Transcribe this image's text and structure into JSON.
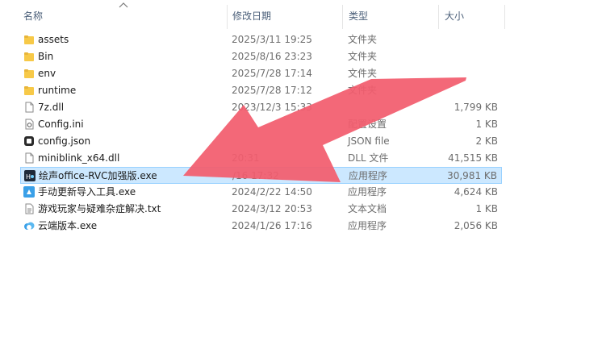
{
  "columns": {
    "name": "名称",
    "date": "修改日期",
    "type": "类型",
    "size": "大小"
  },
  "rows": [
    {
      "name": "assets",
      "date": "2025/3/11 19:25",
      "type": "文件夹",
      "size": "",
      "icon": "folder-icon"
    },
    {
      "name": "Bin",
      "date": "2025/8/16 23:23",
      "type": "文件夹",
      "size": "",
      "icon": "folder-icon"
    },
    {
      "name": "env",
      "date": "2025/7/28 17:14",
      "type": "文件夹",
      "size": "",
      "icon": "folder-icon"
    },
    {
      "name": "runtime",
      "date": "2025/7/28 17:12",
      "type": "文件夹",
      "size": "",
      "icon": "folder-icon"
    },
    {
      "name": "7z.dll",
      "date": "2023/12/3 15:33",
      "type": "",
      "size": "1,799 KB",
      "icon": "file-icon"
    },
    {
      "name": "Config.ini",
      "date": "",
      "type": "配置设置",
      "size": "1 KB",
      "icon": "ini-file-icon"
    },
    {
      "name": "config.json",
      "date": "",
      "type": "JSON file",
      "size": "2 KB",
      "icon": "json-file-icon"
    },
    {
      "name": "miniblink_x64.dll",
      "date": "20:31",
      "type": "DLL 文件",
      "size": "41,515 KB",
      "icon": "file-icon"
    },
    {
      "name": "绘声office-RVC加强版.exe",
      "date": "/16 17:32",
      "type": "应用程序",
      "size": "30,981 KB",
      "icon": "app-exe-icon",
      "selected": true
    },
    {
      "name": "手动更新导入工具.exe",
      "date": "2024/2/22 14:50",
      "type": "应用程序",
      "size": "4,624 KB",
      "icon": "update-tool-icon"
    },
    {
      "name": "游戏玩家与疑难杂症解决.txt",
      "date": "2024/3/12 20:53",
      "type": "文本文档",
      "size": "1 KB",
      "icon": "text-file-icon"
    },
    {
      "name": "云端版本.exe",
      "date": "2024/1/26 17:16",
      "type": "应用程序",
      "size": "2,056 KB",
      "icon": "cloud-exe-icon"
    }
  ],
  "colors": {
    "selected_bg": "#cce8ff",
    "selected_border": "#99d1ff",
    "folder": "#f7c948",
    "arrow": "#f25c6e"
  }
}
